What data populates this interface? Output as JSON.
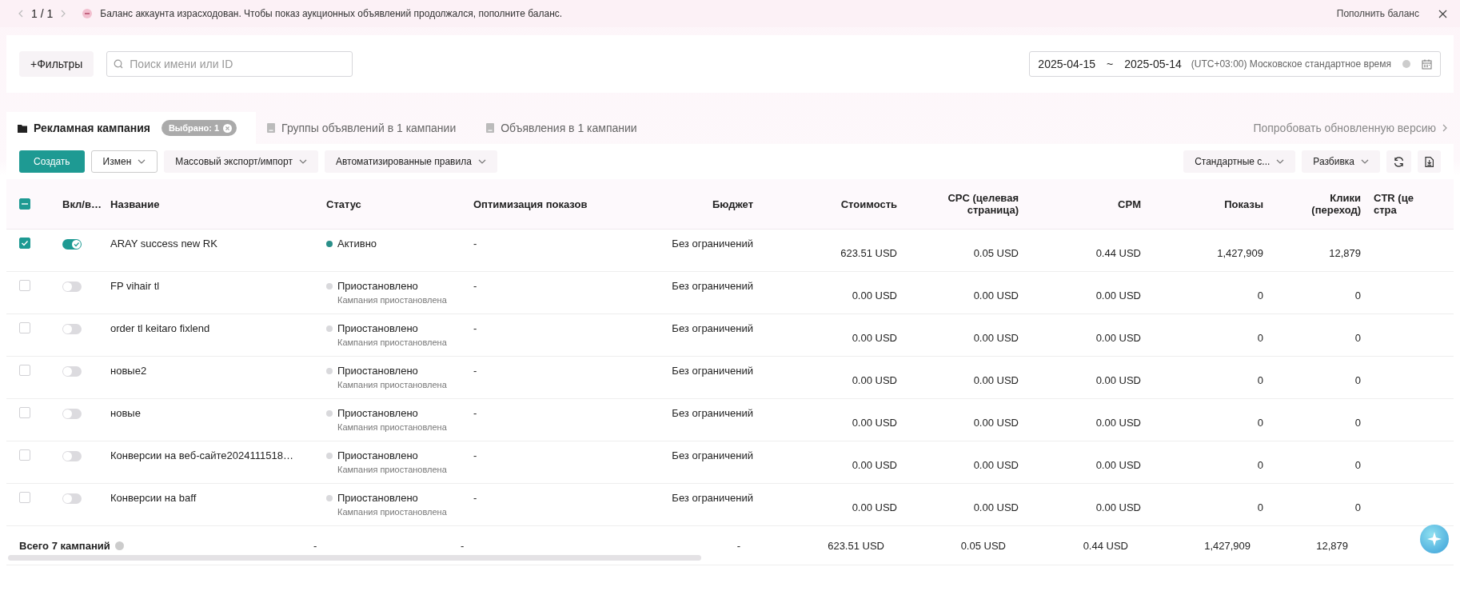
{
  "banner": {
    "pager": "1 / 1",
    "message": "Баланс аккаунта израсходован. Чтобы показ аукционных объявлений продолжался, пополните баланс.",
    "action": "Пополнить баланс"
  },
  "filters": {
    "button": "+Фильтры",
    "search_placeholder": "Поиск имени или ID"
  },
  "date_range": {
    "start": "2025-04-15",
    "separator": "~",
    "end": "2025-05-14",
    "timezone": "(UTC+03:00) Московское стандартное время"
  },
  "tabs": [
    {
      "label": "Рекламная кампания",
      "selected": true,
      "badge": "Выбрано: 1"
    },
    {
      "label": "Группы объявлений в 1 кампании",
      "selected": false
    },
    {
      "label": "Объявления в 1 кампании",
      "selected": false
    }
  ],
  "try_new_version": "Попробовать обновленную версию",
  "toolbar": {
    "left": [
      {
        "label": "Создать",
        "kind": "primary"
      },
      {
        "label": "Измен",
        "kind": "outline"
      },
      {
        "label": "Массовый экспорт/импорт",
        "kind": "dropdown"
      },
      {
        "label": "Автоматизированные правила",
        "kind": "dropdown"
      }
    ],
    "right": [
      {
        "label": "Стандартные с...",
        "kind": "dropdown"
      },
      {
        "label": "Разбивка",
        "kind": "dropdown"
      }
    ]
  },
  "table": {
    "header_checkbox": {
      "indeterminate": true
    },
    "columns": [
      {
        "lines": [
          "Вкл/в…"
        ]
      },
      {
        "lines": [
          "Название"
        ]
      },
      {
        "lines": [
          "Статус"
        ]
      },
      {
        "lines": [
          "Оптимизация показов"
        ]
      },
      {
        "lines": [
          "Бюджет"
        ]
      },
      {
        "lines": [
          "Стоимость"
        ]
      },
      {
        "lines": [
          "CPC (целевая",
          "страница)"
        ]
      },
      {
        "lines": [
          "CPM"
        ]
      },
      {
        "lines": [
          "Показы"
        ]
      },
      {
        "lines": [
          "Клики",
          "(переход)"
        ]
      },
      {
        "lines": [
          "CTR (це",
          "стра"
        ]
      }
    ],
    "rows": [
      {
        "checked": true,
        "on": true,
        "name": "ARAY success new RK",
        "status": {
          "label": "Активно",
          "color": "#2a8f89"
        },
        "optimization": "-",
        "budget": "Без ограничений",
        "cost": "623.51 USD",
        "cpc": "0.05 USD",
        "cpm": "0.44 USD",
        "impressions": "1,427,909",
        "clicks": "12,879"
      },
      {
        "checked": false,
        "on": false,
        "name": "FP vihair tl",
        "status": {
          "label": "Приостановлено",
          "note": "Кампания приостановлена",
          "color": "#d9d9dc"
        },
        "optimization": "-",
        "budget": "Без ограничений",
        "cost": "0.00 USD",
        "cpc": "0.00 USD",
        "cpm": "0.00 USD",
        "impressions": "0",
        "clicks": "0"
      },
      {
        "checked": false,
        "on": false,
        "name": "order tl keitaro fixlend",
        "status": {
          "label": "Приостановлено",
          "note": "Кампания приостановлена",
          "color": "#d9d9dc"
        },
        "optimization": "-",
        "budget": "Без ограничений",
        "cost": "0.00 USD",
        "cpc": "0.00 USD",
        "cpm": "0.00 USD",
        "impressions": "0",
        "clicks": "0"
      },
      {
        "checked": false,
        "on": false,
        "name": "новые2",
        "status": {
          "label": "Приостановлено",
          "note": "Кампания приостановлена",
          "color": "#d9d9dc"
        },
        "optimization": "-",
        "budget": "Без ограничений",
        "cost": "0.00 USD",
        "cpc": "0.00 USD",
        "cpm": "0.00 USD",
        "impressions": "0",
        "clicks": "0"
      },
      {
        "checked": false,
        "on": false,
        "name": "новые",
        "status": {
          "label": "Приостановлено",
          "note": "Кампания приостановлена",
          "color": "#d9d9dc"
        },
        "optimization": "-",
        "budget": "Без ограничений",
        "cost": "0.00 USD",
        "cpc": "0.00 USD",
        "cpm": "0.00 USD",
        "impressions": "0",
        "clicks": "0"
      },
      {
        "checked": false,
        "on": false,
        "name": "Конверсии на веб-сайте2024111518…",
        "status": {
          "label": "Приостановлено",
          "note": "Кампания приостановлена",
          "color": "#d9d9dc"
        },
        "optimization": "-",
        "budget": "Без ограничений",
        "cost": "0.00 USD",
        "cpc": "0.00 USD",
        "cpm": "0.00 USD",
        "impressions": "0",
        "clicks": "0"
      },
      {
        "checked": false,
        "on": false,
        "name": "Конверсии на baff",
        "status": {
          "label": "Приостановлено",
          "note": "Кампания приостановлена",
          "color": "#d9d9dc"
        },
        "optimization": "-",
        "budget": "Без ограничений",
        "cost": "0.00 USD",
        "cpc": "0.00 USD",
        "cpm": "0.00 USD",
        "impressions": "0",
        "clicks": "0"
      }
    ],
    "footer": {
      "label": "Всего 7 кампаний",
      "status": "-",
      "optimization": "-",
      "budget": "-",
      "cost": "623.51 USD",
      "cpc": "0.05 USD",
      "cpm": "0.44 USD",
      "impressions": "1,427,909",
      "clicks": "12,879"
    }
  }
}
